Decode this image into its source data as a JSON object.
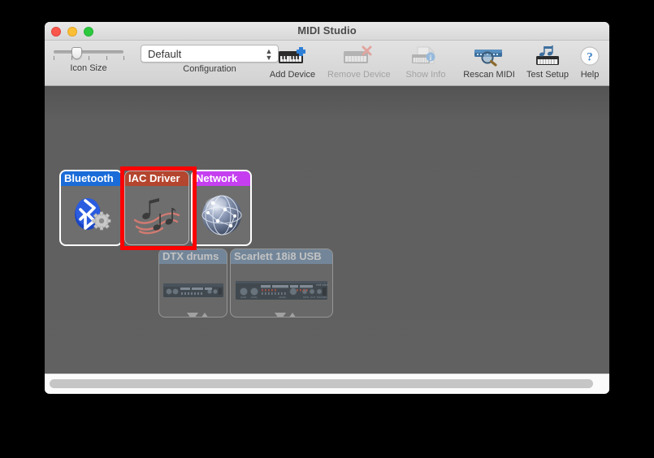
{
  "window": {
    "title": "MIDI Studio",
    "controls": {
      "close": "close-button",
      "minimize": "minimize-button",
      "maximize": "maximize-button"
    }
  },
  "toolbar": {
    "icon_size": {
      "label": "Icon Size",
      "value_percent": 33,
      "tick_count": 5
    },
    "configuration": {
      "label": "Configuration",
      "value": "Default",
      "options": [
        "Default"
      ]
    },
    "buttons": [
      {
        "id": "add-device",
        "label": "Add Device",
        "icon": "keyboard-plus-icon",
        "enabled": true
      },
      {
        "id": "remove-device",
        "label": "Remove Device",
        "icon": "keyboard-x-icon",
        "enabled": false
      },
      {
        "id": "show-info",
        "label": "Show Info",
        "icon": "keyboard-info-icon",
        "enabled": false
      },
      {
        "id": "rescan-midi",
        "label": "Rescan MIDI",
        "icon": "interface-search-icon",
        "enabled": true
      },
      {
        "id": "test-setup",
        "label": "Test Setup",
        "icon": "keyboard-notes-icon",
        "enabled": true
      },
      {
        "id": "help",
        "label": "Help",
        "icon": "question-mark-icon",
        "enabled": true
      }
    ]
  },
  "canvas": {
    "background_color": "#5e5e5e",
    "devices": [
      {
        "id": "bluetooth",
        "name": "Bluetooth",
        "header_color": "#1b6cd8",
        "icon": "bluetooth-gear-icon",
        "state": "selected",
        "online": true,
        "has_ports": false
      },
      {
        "id": "iac-driver",
        "name": "IAC Driver",
        "header_color": "#b4452e",
        "icon": "music-notes-icon",
        "state": "normal",
        "online": true,
        "has_ports": false
      },
      {
        "id": "network",
        "name": "Network",
        "header_color": "#c53ff0",
        "icon": "globe-network-icon",
        "state": "selected",
        "online": true,
        "has_ports": false
      },
      {
        "id": "dtx-drums",
        "name": "DTX drums",
        "header_color": "#7f9ebd",
        "icon": "midi-module-icon",
        "state": "normal",
        "online": false,
        "has_ports": true
      },
      {
        "id": "scarlett-18i8-usb",
        "name": "Scarlett 18i8 USB",
        "header_color": "#7f9ebd",
        "icon": "audio-interface-icon",
        "state": "normal",
        "online": false,
        "has_ports": true
      }
    ]
  },
  "annotation": {
    "highlight_color": "#fe0000",
    "target_device": "IAC Driver"
  },
  "scrollbar": {
    "orientation": "horizontal",
    "thumb_color": "#c6c6c6"
  }
}
